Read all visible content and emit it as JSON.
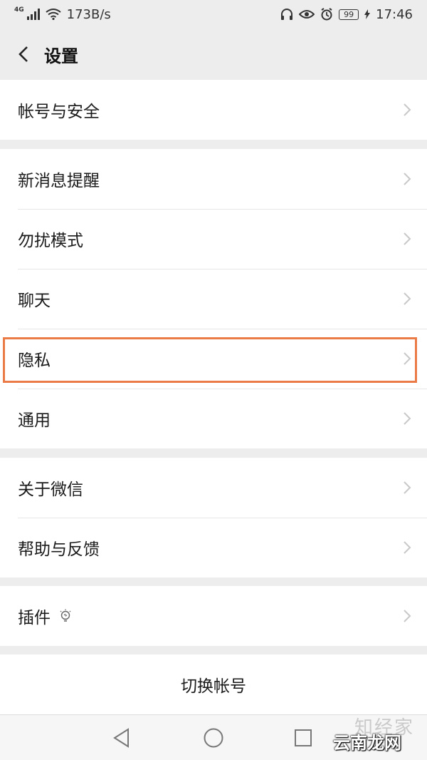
{
  "status": {
    "network_type": "4G",
    "speed": "173B/s",
    "battery": "99",
    "time": "17:46"
  },
  "header": {
    "title": "设置"
  },
  "groups": [
    {
      "items": [
        {
          "label": "帐号与安全"
        }
      ]
    },
    {
      "items": [
        {
          "label": "新消息提醒"
        },
        {
          "label": "勿扰模式"
        },
        {
          "label": "聊天"
        },
        {
          "label": "隐私",
          "highlighted": true
        },
        {
          "label": "通用"
        }
      ]
    },
    {
      "items": [
        {
          "label": "关于微信"
        },
        {
          "label": "帮助与反馈"
        }
      ]
    },
    {
      "items": [
        {
          "label": "插件",
          "icon": "lightbulb-icon"
        }
      ]
    }
  ],
  "switch_account": {
    "label": "切换帐号"
  },
  "nav": {
    "icons": [
      "back-triangle-icon",
      "home-circle-icon",
      "recents-square-icon"
    ]
  },
  "watermark": {
    "line1": "知经家",
    "line2": "云南龙网"
  },
  "colors": {
    "highlight": "#ea7a46",
    "background": "#ededed",
    "card": "#ffffff"
  }
}
